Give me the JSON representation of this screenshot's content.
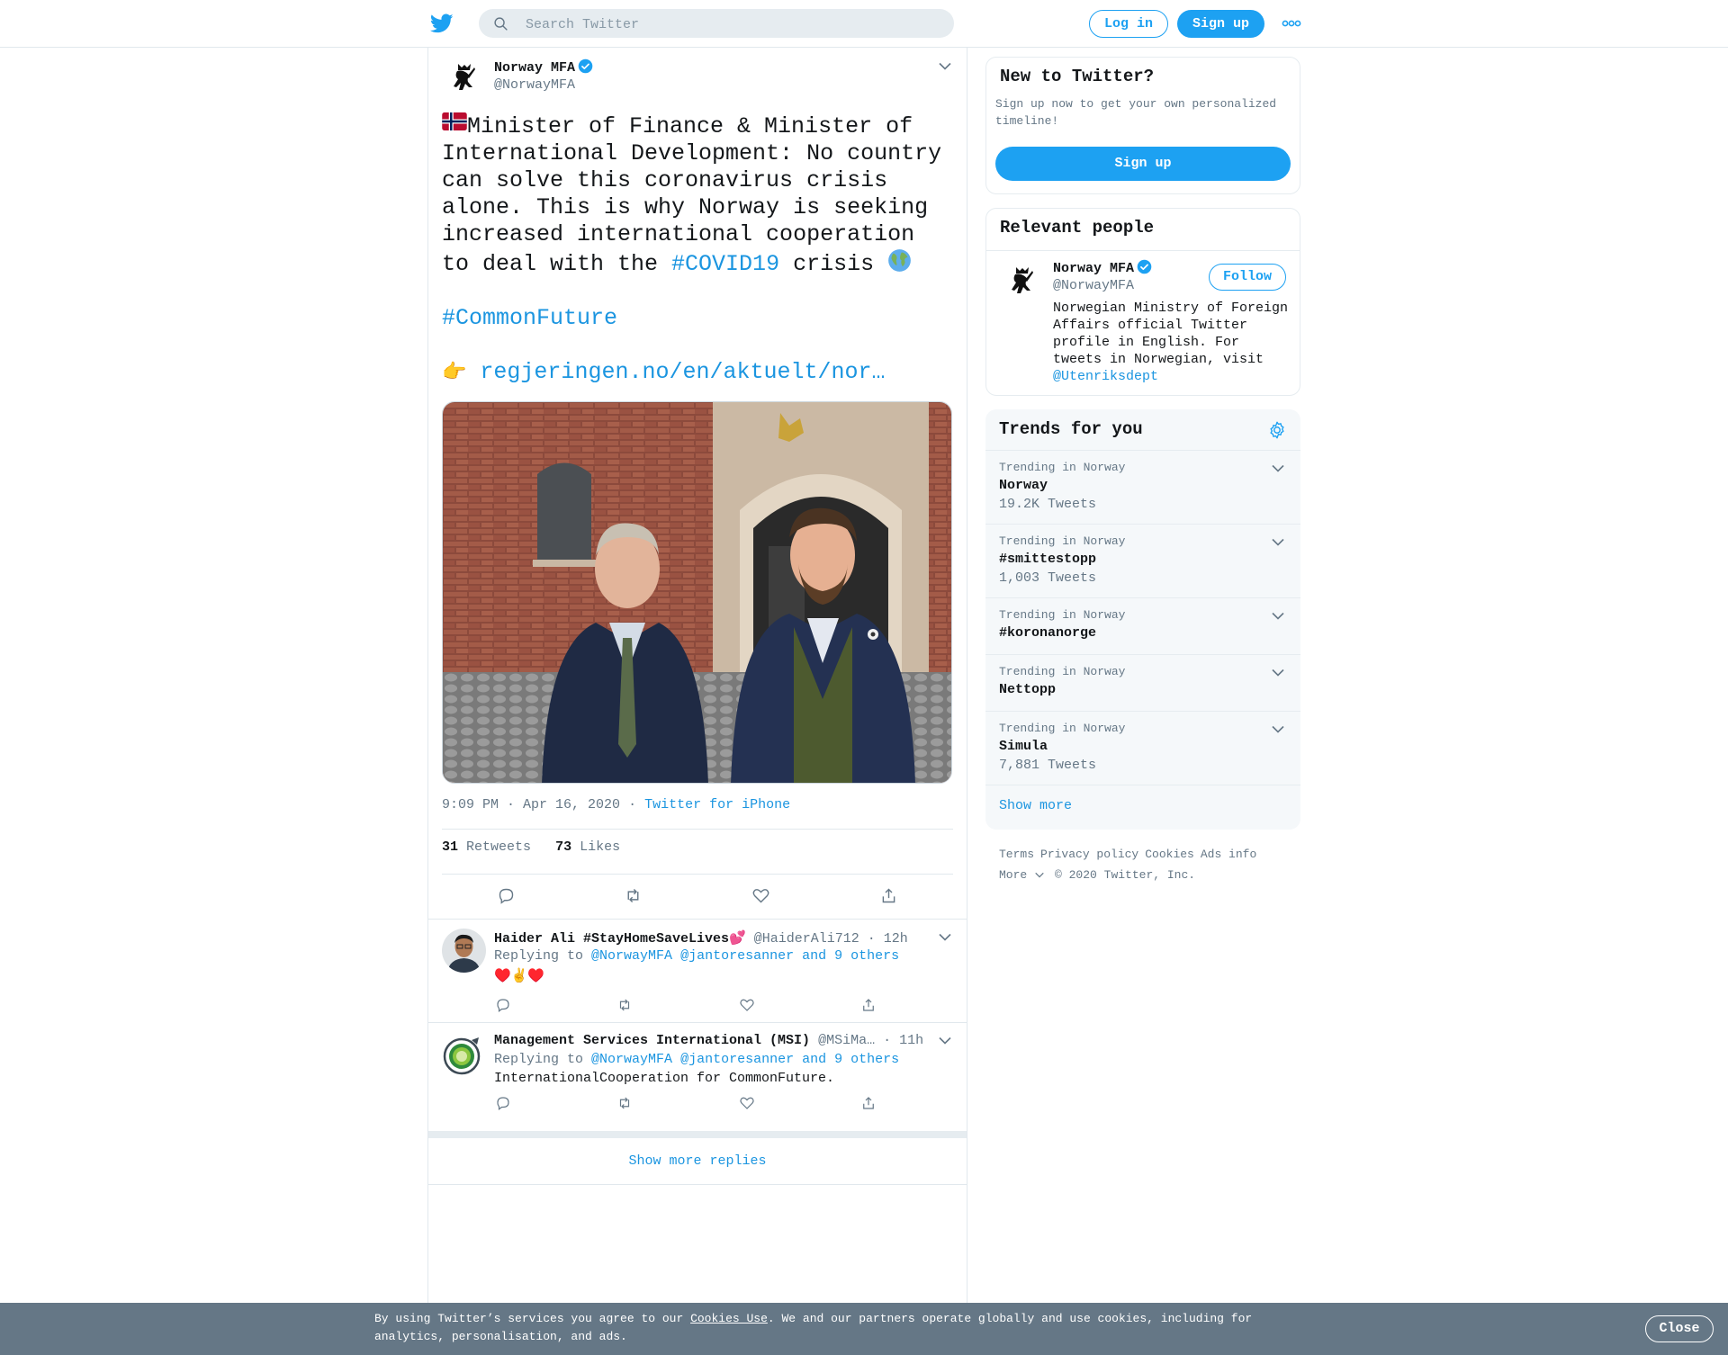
{
  "header": {
    "search_placeholder": "Search Twitter",
    "login_label": "Log in",
    "signup_label": "Sign up"
  },
  "tweet": {
    "author_name": "Norway MFA",
    "author_handle": "@NorwayMFA",
    "text_main": "Minister of Finance & Minister of International Development: No country can solve this coronavirus crisis alone. This is why Norway is seeking increased international cooperation to deal with the ",
    "hashtag_covid": "#COVID19",
    "text_after": " crisis ",
    "hashtag_future": "#CommonFuture",
    "pointer_emoji": "👉",
    "link_text": "regjeringen.no/en/aktuelt/nor…",
    "time": "9:09 PM · Apr 16, 2020",
    "meta_sep": "·",
    "source": "Twitter for iPhone",
    "retweets_count": "31",
    "retweets_label": "Retweets",
    "likes_count": "73",
    "likes_label": "Likes"
  },
  "replies": [
    {
      "name": "Haider Ali #StayHomeSaveLives💕",
      "handle": "@HaiderAli712",
      "time": "· 12h",
      "replying_prefix": "Replying to",
      "replying_to": "@NorwayMFA @jantoresanner and 9 others",
      "text": "♥️✌️♥️"
    },
    {
      "name": "Management Services International (MSI)",
      "handle": "@MSiMa…",
      "time": "· 11h",
      "replying_prefix": "Replying to",
      "replying_to": "@NorwayMFA @jantoresanner and 9 others",
      "text": "InternationalCooperation for CommonFuture."
    }
  ],
  "show_more_replies": "Show more replies",
  "new_to_twitter": {
    "title": "New to Twitter?",
    "desc": "Sign up now to get your own personalized timeline!",
    "button": "Sign up"
  },
  "relevant_people": {
    "title": "Relevant people",
    "name": "Norway MFA",
    "handle": "@NorwayMFA",
    "follow": "Follow",
    "bio": "Norwegian Ministry of Foreign Affairs official Twitter profile in English. For tweets in Norwegian, visit ",
    "bio_link": "@Utenriksdept"
  },
  "trends": {
    "title": "Trends for you",
    "items": [
      {
        "context": "Trending in Norway",
        "name": "Norway",
        "count": "19.2K Tweets"
      },
      {
        "context": "Trending in Norway",
        "name": "#smittestopp",
        "count": "1,003 Tweets"
      },
      {
        "context": "Trending in Norway",
        "name": "#koronanorge",
        "count": ""
      },
      {
        "context": "Trending in Norway",
        "name": "Nettopp",
        "count": ""
      },
      {
        "context": "Trending in Norway",
        "name": "Simula",
        "count": "7,881 Tweets"
      }
    ],
    "show_more": "Show more"
  },
  "footer": {
    "links": [
      "Terms",
      "Privacy policy",
      "Cookies",
      "Ads info"
    ],
    "more": "More",
    "copyright": "© 2020 Twitter, Inc."
  },
  "cookie_banner": {
    "text_before": "By using Twitter’s services you agree to our ",
    "link": "Cookies Use",
    "text_after": ". We and our partners operate globally and use cookies, including for analytics, personalisation, and ads.",
    "close": "Close"
  },
  "colors": {
    "brand": "#1da1f2",
    "link": "#1b95e0",
    "muted": "#657786",
    "border": "#e1e8ed",
    "banner": "#657786"
  }
}
